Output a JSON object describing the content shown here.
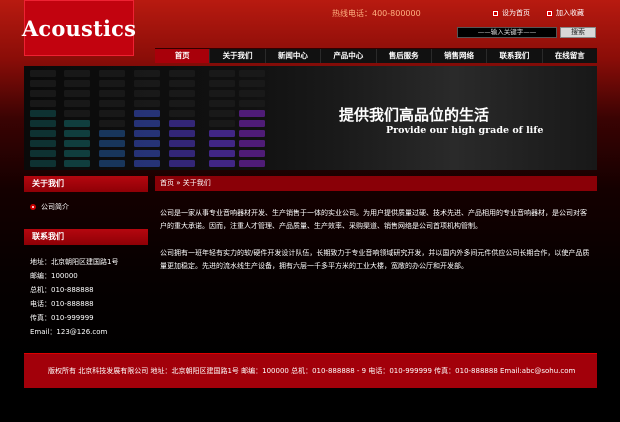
{
  "logo": "Acoustics",
  "hotline": "热线电话：400-800000",
  "top_links": {
    "home": "设为首页",
    "favorite": "加入收藏"
  },
  "search": {
    "placeholder": "——输入关键字——",
    "button": "搜索"
  },
  "nav": [
    "首页",
    "关于我们",
    "新闻中心",
    "产品中心",
    "售后服务",
    "销售网络",
    "联系我们",
    "在线留言"
  ],
  "banner": {
    "title_cn": "提供我们高品位的生活",
    "title_en": "Provide our high grade of life"
  },
  "sidebar": {
    "about_title": "关于我们",
    "about_link": "公司简介",
    "contact_title": "联系我们",
    "contact": {
      "address": "地址：北京朝阳区建国路1号",
      "postcode": "邮编：100000",
      "phone_main": "总机：010-888888",
      "phone": "电话：010-888888",
      "fax": "传真：010-999999",
      "email": "Email：123@126.com"
    }
  },
  "breadcrumb": "首页 » 关于我们",
  "content": {
    "para1": "公司是一家从事专业音响器材开发、生产销售于一体的实业公司。为用户提供质量过硬、技术先进、产品相用的专业音响器材，是公司对客户的重大承诺。因而，注重人才管理、产品质量、生产效率、采购渠道、销售网络是公司首项机构管制。",
    "para2": "公司拥有一班年轻有实力的软/硬件开发设计队伍，长期致力于专业音响领域研究开发，并以国内外多间元件供应公司长期合作，以使产品质量更加稳定。先进的流水线生产设备，拥有六层一千多平方米的工业大楼，宽敞的办公厅和开发部。"
  },
  "footer": "版权所有  北京科技发展有限公司  地址：北京朝阳区建国路1号  邮编：100000    总机：010-888888 - 9  电话：010-999999  传真：010-888888  Email:abc@sohu.com",
  "colors": {
    "brand_red": "#c2030f",
    "nav_active": "#a8000a"
  }
}
